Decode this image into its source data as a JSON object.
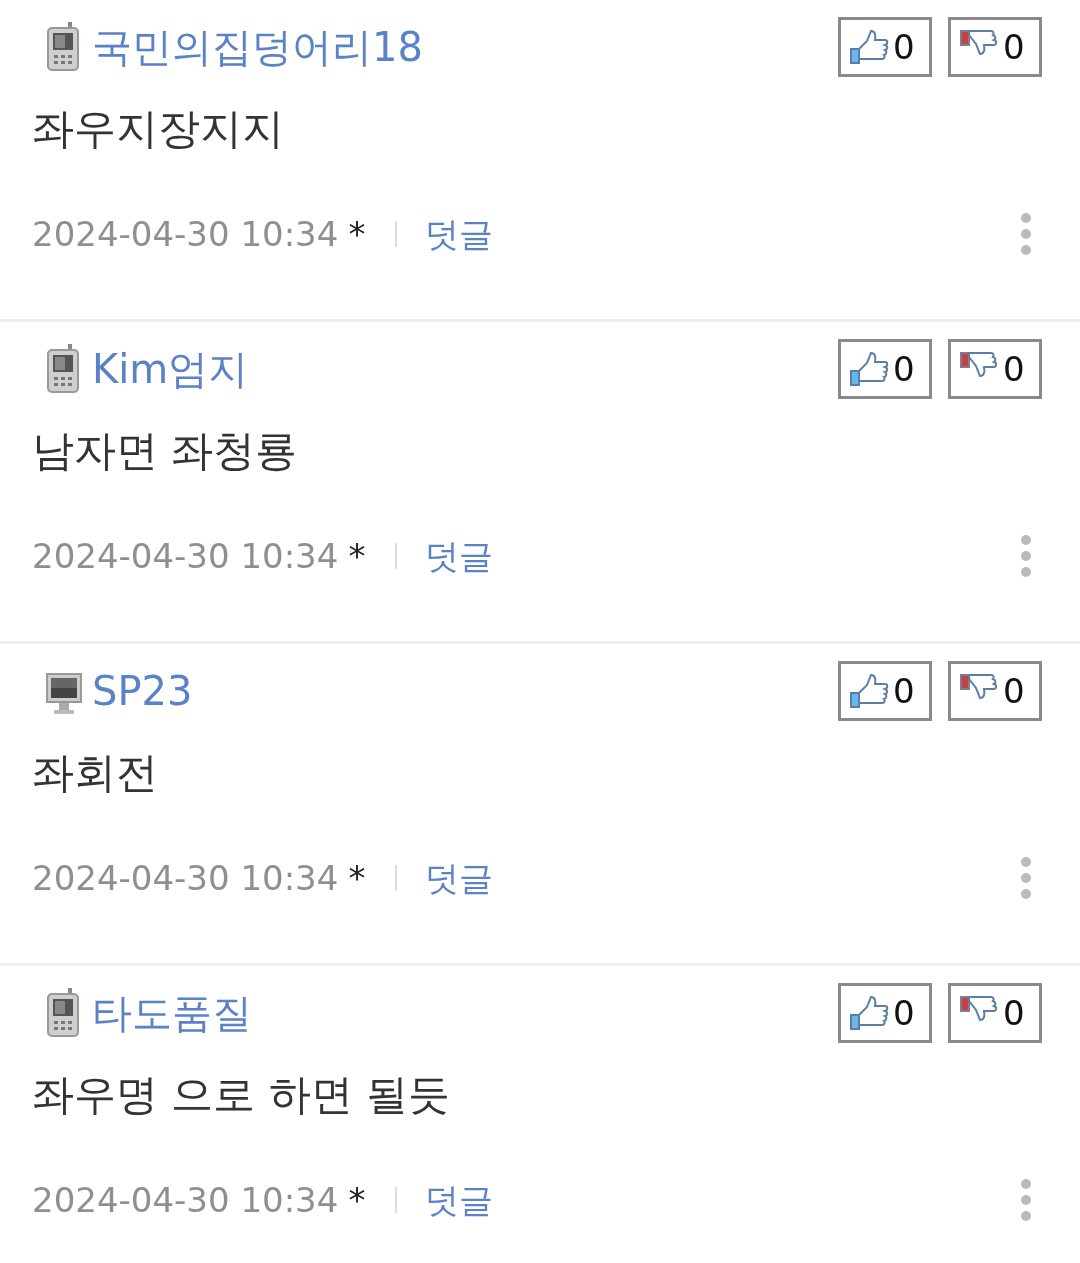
{
  "comments": [
    {
      "kind": "mobile",
      "author": "국민의집덩어리18",
      "likes": "0",
      "dislikes": "0",
      "body": "좌우지장지지",
      "date": "2024-04-30 10:34",
      "mark": "*",
      "reply": "덧글"
    },
    {
      "kind": "mobile",
      "author": "Kim엄지",
      "likes": "0",
      "dislikes": "0",
      "body": "남자면 좌청룡",
      "date": "2024-04-30 10:34",
      "mark": "*",
      "reply": "덧글"
    },
    {
      "kind": "pc",
      "author": "SP23",
      "likes": "0",
      "dislikes": "0",
      "body": "좌회전",
      "date": "2024-04-30 10:34",
      "mark": "*",
      "reply": "덧글"
    },
    {
      "kind": "mobile",
      "author": "타도품질",
      "likes": "0",
      "dislikes": "0",
      "body": "좌우명 으로 하면 될듯",
      "date": "2024-04-30 10:34",
      "mark": "*",
      "reply": "덧글"
    }
  ]
}
